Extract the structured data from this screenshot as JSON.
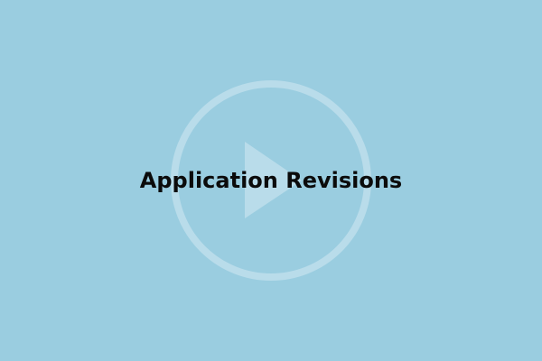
{
  "video": {
    "title": "Application Revisions",
    "icon": "play-icon"
  },
  "colors": {
    "background": "#9acde0",
    "play_icon": "#b9dcea",
    "title_text": "#0b0b0b"
  }
}
